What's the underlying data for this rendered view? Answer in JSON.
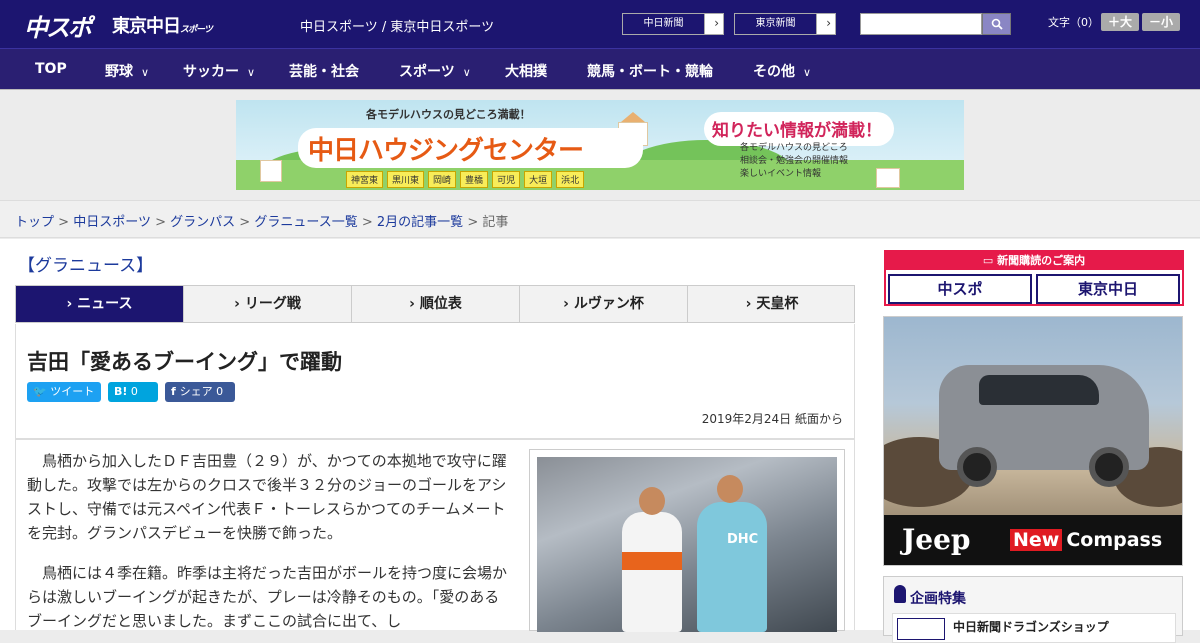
{
  "header": {
    "logo_main": "中スポ",
    "logo_sub": "東京中日",
    "logo_sub_small": "スポーツ",
    "site_names": "中日スポーツ / 東京中日スポーツ",
    "paper_buttons": [
      {
        "label": "中日新聞",
        "arrow": "›"
      },
      {
        "label": "東京新聞",
        "arrow": "›"
      }
    ],
    "search_placeholder": "",
    "font_size_label": "文字（0）",
    "font_bigger": "＋大",
    "font_smaller": "－小"
  },
  "nav": {
    "items": [
      {
        "label": "TOP",
        "chevron": ""
      },
      {
        "label": "野球",
        "chevron": "∨"
      },
      {
        "label": "サッカー",
        "chevron": "∨"
      },
      {
        "label": "芸能・社会",
        "chevron": ""
      },
      {
        "label": "スポーツ",
        "chevron": "∨"
      },
      {
        "label": "大相撲",
        "chevron": ""
      },
      {
        "label": "競馬・ボート・競輪",
        "chevron": ""
      },
      {
        "label": "その他",
        "chevron": "∨"
      }
    ]
  },
  "banner": {
    "subtitle": "各モデルハウスの見どころ満載！",
    "title": "中日ハウジングセンター",
    "headline": "知りたい情報が満載！",
    "cities": [
      "神宮東",
      "黒川東",
      "岡崎",
      "豊橋",
      "可児",
      "大垣",
      "浜北"
    ],
    "info": [
      "各モデルハウスの見どころ",
      "相談会・勉強会の開催情報",
      "楽しいイベント情報"
    ]
  },
  "breadcrumb": {
    "links": [
      "トップ",
      "中日スポーツ",
      "グランパス",
      "グラニュース一覧",
      "2月の記事一覧"
    ],
    "current": "記事",
    "separator": ">"
  },
  "category": "【グラニュース】",
  "tabs": [
    {
      "label": "ニュース",
      "active": true
    },
    {
      "label": "リーグ戦",
      "active": false
    },
    {
      "label": "順位表",
      "active": false
    },
    {
      "label": "ルヴァン杯",
      "active": false
    },
    {
      "label": "天皇杯",
      "active": false
    }
  ],
  "article": {
    "title": "吉田「愛あるブーイング」で躍動",
    "share": {
      "tweet": "ツイート",
      "hatena_icon": "B!",
      "hatena_count": "0",
      "fb_label": "シェア",
      "fb_count": "0"
    },
    "date": "2019年2月24日 紙面から",
    "paragraphs": [
      "鳥栖から加入したＤＦ吉田豊（２９）が、かつての本拠地で攻守に躍動した。攻撃では左からのクロスで後半３２分のジョーのゴールをアシストし、守備では元スペイン代表Ｆ・トーレスらかつてのチームメートを完封。グランパスデビューを快勝で飾った。",
      "鳥栖には４季在籍。昨季は主将だった吉田がボールを持つ度に会場からは激しいブーイングが起きたが、プレーは冷静そのもの。「愛のあるブーイングだと思いました。まずここの試合に出て、し"
    ],
    "photo_text": "DHC"
  },
  "sidebar": {
    "subscribe_header": "新聞購読のご案内",
    "subscribe_buttons": [
      "中スポ",
      "東京中日"
    ],
    "ad_brand": "Jeep",
    "ad_new": "New",
    "ad_model": "Compass",
    "feature_title": "企画特集",
    "feature_item": "中日新聞ドラゴンズショップ"
  },
  "colors": {
    "primary": "#1c1570",
    "accent": "#e61a4a",
    "twitter": "#1da1f2",
    "hatena": "#00a4de",
    "facebook": "#3b5998"
  }
}
